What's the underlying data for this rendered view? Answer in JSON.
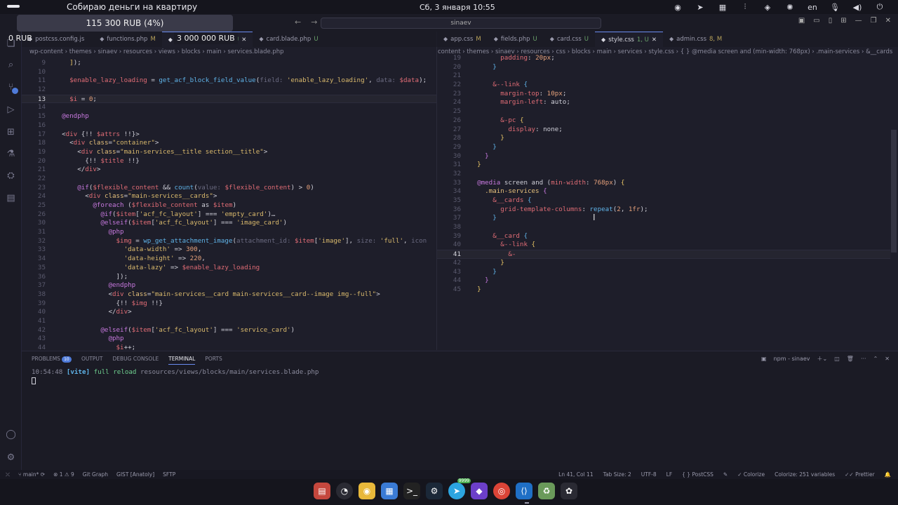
{
  "topbar": {
    "window_title": "Собираю деньги на квартиру",
    "clock": "Сб, 3 января 10:55",
    "lang": "en",
    "tray_icons": [
      "opera-icon",
      "telegram-icon",
      "grid-icon",
      "sliders-icon",
      "discord-icon",
      "settings-icon",
      "lang",
      "mic-icon",
      "volume-icon",
      "power-icon"
    ]
  },
  "overlay": {
    "balance_progress": "115 300 RUB (4%)",
    "balance_small": "0 RUB",
    "goal": "3 000 000 RUB"
  },
  "titlebar": {
    "search": "sinaev"
  },
  "left_tabs": [
    {
      "label": "postcss.config.js",
      "mark": "",
      "active": false
    },
    {
      "label": "functions.php",
      "mark": "M",
      "active": false
    },
    {
      "label": "services.blade.php",
      "mark": "U",
      "active": true
    },
    {
      "label": "card.blade.php",
      "mark": "U",
      "active": false
    }
  ],
  "right_tabs": [
    {
      "label": "app.css",
      "mark": "M",
      "active": false
    },
    {
      "label": "fields.php",
      "mark": "U",
      "active": false
    },
    {
      "label": "card.css",
      "mark": "U",
      "active": false
    },
    {
      "label": "style.css",
      "mark": "1, U",
      "active": true
    },
    {
      "label": "admin.css",
      "mark": "8, M",
      "active": false
    }
  ],
  "left_breadcrumb": "wp-content › themes › sinaev › resources › views › blocks › main › services.blade.php",
  "right_breadcrumb": "content › themes › sinaev › resources › css › blocks › main › services › style.css › { } @media screen and (min-width: 768px) › .main-services › &__cards",
  "left_code": [
    {
      "n": "9",
      "html": "    <span class='bk'>]</span>);"
    },
    {
      "n": "10",
      "html": ""
    },
    {
      "n": "11",
      "html": "    <span class='var'>$enable_lazy_loading</span> = <span class='fn'>get_acf_block_field_value</span>(<span class='hint'>field: </span><span class='str'>'enable_lazy_loading'</span>, <span class='hint'>data: </span><span class='var'>$data</span>);"
    },
    {
      "n": "12",
      "html": ""
    },
    {
      "n": "13",
      "html": "    <span class='var'>$i</span> = <span class='num'>0</span>;",
      "cur": true
    },
    {
      "n": "14",
      "html": ""
    },
    {
      "n": "15",
      "html": "  <span class='kw'>@endphp</span>"
    },
    {
      "n": "16",
      "html": ""
    },
    {
      "n": "17",
      "html": "  &lt;<span class='tag'>div</span> {!! <span class='var'>$attrs</span> !!}&gt;"
    },
    {
      "n": "18",
      "html": "    &lt;<span class='tag'>div</span> <span class='cls'>class</span>=<span class='str'>\"container\"</span>&gt;"
    },
    {
      "n": "19",
      "html": "      &lt;<span class='tag'>div</span> <span class='cls'>class</span>=<span class='str'>\"main-services__title section__title\"</span>&gt;"
    },
    {
      "n": "20",
      "html": "        {!! <span class='var'>$title</span> !!}"
    },
    {
      "n": "21",
      "html": "      &lt;/<span class='tag'>div</span>&gt;"
    },
    {
      "n": "22",
      "html": ""
    },
    {
      "n": "23",
      "html": "      <span class='kw'>@if</span>(<span class='var'>$flexible_content</span> &amp;&amp; <span class='fn'>count</span>(<span class='hint'>value: </span><span class='var'>$flexible_content</span>) &gt; <span class='num'>0</span>)"
    },
    {
      "n": "24",
      "html": "        &lt;<span class='tag'>div</span> <span class='cls'>class</span>=<span class='str'>\"main-services__cards\"</span>&gt;"
    },
    {
      "n": "25",
      "html": "          <span class='kw'>@foreach</span> (<span class='var'>$flexible_content</span> as <span class='var'>$item</span>)"
    },
    {
      "n": "26",
      "html": "            <span class='kw'>@if</span>(<span class='var'>$item</span>[<span class='str'>'acf_fc_layout'</span>] === <span class='str'>'empty_card'</span>)…"
    },
    {
      "n": "30",
      "html": "            <span class='kw'>@elseif</span>(<span class='var'>$item</span>[<span class='str'>'acf_fc_layout'</span>] === <span class='str'>'image_card'</span>)"
    },
    {
      "n": "31",
      "html": "              <span class='kw'>@php</span>"
    },
    {
      "n": "32",
      "html": "                <span class='var'>$img</span> = <span class='fn'>wp_get_attachment_image</span>(<span class='hint'>attachment_id: </span><span class='var'>$item</span>[<span class='str'>'image'</span>], <span class='hint'>size: </span><span class='str'>'full'</span>, <span class='hint'>icon</span>"
    },
    {
      "n": "33",
      "html": "                  <span class='str'>'data-width'</span> =&gt; <span class='num'>300</span>,"
    },
    {
      "n": "34",
      "html": "                  <span class='str'>'data-height'</span> =&gt; <span class='num'>220</span>,"
    },
    {
      "n": "35",
      "html": "                  <span class='str'>'data-lazy'</span> =&gt; <span class='var'>$enable_lazy_loading</span>"
    },
    {
      "n": "36",
      "html": "                ]);"
    },
    {
      "n": "37",
      "html": "              <span class='kw'>@endphp</span>"
    },
    {
      "n": "38",
      "html": "              &lt;<span class='tag'>div</span> <span class='cls'>class</span>=<span class='str'>\"main-services__card main-services__card--image img--full\"</span>&gt;"
    },
    {
      "n": "39",
      "html": "                {!! <span class='var'>$img</span> !!}"
    },
    {
      "n": "40",
      "html": "              &lt;/<span class='tag'>div</span>&gt;"
    },
    {
      "n": "41",
      "html": ""
    },
    {
      "n": "42",
      "html": "            <span class='kw'>@elseif</span>(<span class='var'>$item</span>[<span class='str'>'acf_fc_layout'</span>] === <span class='str'>'service_card'</span>)"
    },
    {
      "n": "43",
      "html": "              <span class='kw'>@php</span>"
    },
    {
      "n": "44",
      "html": "                <span class='var'>$i</span>++;"
    }
  ],
  "right_code": [
    {
      "n": "19",
      "html": "        <span class='pr'>padding</span>: <span class='num'>20px</span>;"
    },
    {
      "n": "20",
      "html": "      <span class='bk3'>}</span>"
    },
    {
      "n": "21",
      "html": ""
    },
    {
      "n": "22",
      "html": "      <span class='var'>&amp;--link</span> <span class='bk3'>{</span>"
    },
    {
      "n": "23",
      "html": "        <span class='pr'>margin-top</span>: <span class='num'>10px</span>;"
    },
    {
      "n": "24",
      "html": "        <span class='pr'>margin-left</span>: auto;"
    },
    {
      "n": "25",
      "html": ""
    },
    {
      "n": "26",
      "html": "        <span class='var'>&amp;-pc</span> <span class='bk'>{</span>"
    },
    {
      "n": "27",
      "html": "          <span class='pr'>display</span>: none;"
    },
    {
      "n": "28",
      "html": "        <span class='bk'>}</span>"
    },
    {
      "n": "29",
      "html": "      <span class='bk3'>}</span>"
    },
    {
      "n": "30",
      "html": "    <span class='bk2'>}</span>"
    },
    {
      "n": "31",
      "html": "  <span class='bk'>}</span>"
    },
    {
      "n": "32",
      "html": ""
    },
    {
      "n": "33",
      "html": "  <span class='kw'>@media</span> screen and (<span class='pr'>min-width</span>: <span class='num'>768px</span>) <span class='bk'>{</span>"
    },
    {
      "n": "34",
      "html": "    <span class='cls'>.main-services</span> <span class='bk2'>{</span>"
    },
    {
      "n": "35",
      "html": "      <span class='var'>&amp;__cards</span> <span class='bk3'>{</span>"
    },
    {
      "n": "36",
      "html": "        <span class='pr'>grid-template-columns</span>: <span class='fn'>repeat</span>(<span class='num'>2</span>, <span class='num'>1fr</span>);"
    },
    {
      "n": "37",
      "html": "      <span class='bk3'>}</span>"
    },
    {
      "n": "38",
      "html": ""
    },
    {
      "n": "39",
      "html": "      <span class='var'>&amp;__card</span> <span class='bk3'>{</span>"
    },
    {
      "n": "40",
      "html": "        <span class='var'>&amp;--link</span> <span class='bk'>{</span>"
    },
    {
      "n": "41",
      "html": "          <span class='var'>&amp;-</span>",
      "cur": true
    },
    {
      "n": "42",
      "html": "        <span class='bk'>}</span>"
    },
    {
      "n": "43",
      "html": "      <span class='bk3'>}</span>"
    },
    {
      "n": "44",
      "html": "    <span class='bk2'>}</span>"
    },
    {
      "n": "45",
      "html": "  <span class='bk'>}</span>"
    }
  ],
  "panel": {
    "tabs": [
      "PROBLEMS",
      "OUTPUT",
      "DEBUG CONSOLE",
      "TERMINAL",
      "PORTS"
    ],
    "problems_count": "10",
    "active_tab": "TERMINAL",
    "terminal_name": "npm - sinaev",
    "log_time": "10:54:48",
    "log_tag": "[vite]",
    "log_msg": "full reload",
    "log_path": "resources/views/blocks/main/services.blade.php"
  },
  "status": {
    "branch": "main*",
    "errors": "1",
    "warnings": "9",
    "git_graph": "Git Graph",
    "gist": "GIST [Anatoly]",
    "sftp": "SFTP",
    "position": "Ln 41, Col 11",
    "tab_size": "Tab Size: 2",
    "encoding": "UTF-8",
    "eol": "LF",
    "language": "PostCSS",
    "colorize": "Colorize",
    "colorize_vars": "Colorize: 251 variables",
    "prettier": "Prettier"
  },
  "dock": {
    "apps": [
      "files-icon",
      "browser-icon",
      "music-icon",
      "calculator-icon",
      "terminal-icon",
      "steam-icon",
      "telegram-icon",
      "obsidian-icon",
      "chrome-icon",
      "vscode-icon",
      "trash-icon",
      "settings-icon"
    ],
    "badge": "9999"
  }
}
